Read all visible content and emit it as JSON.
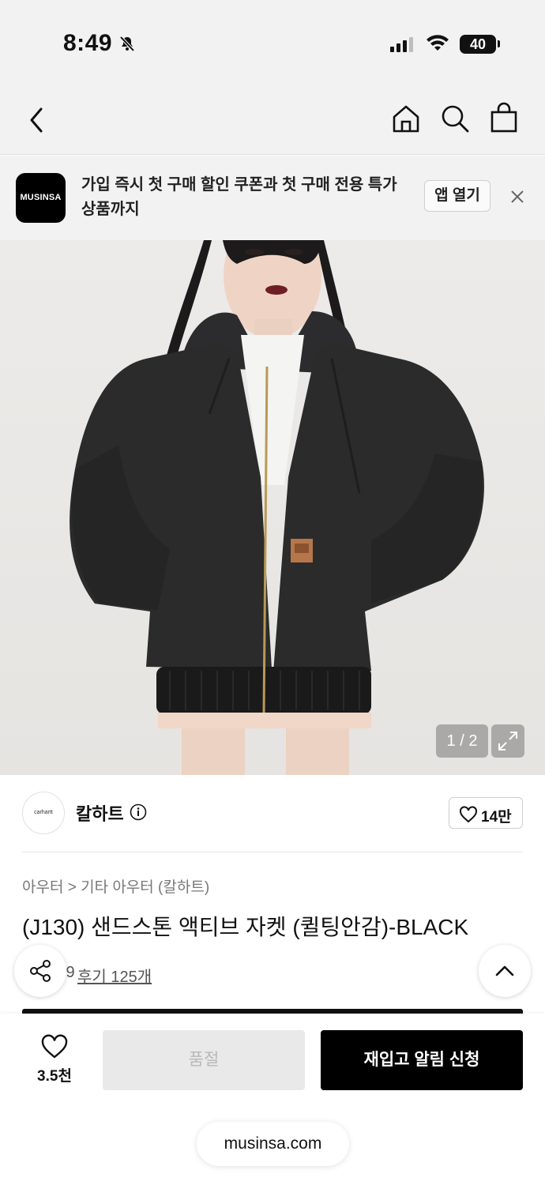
{
  "status_bar": {
    "time": "8:49",
    "battery": "40",
    "icons": [
      "bell-slash-icon",
      "signal-icon",
      "wifi-icon",
      "battery-icon"
    ]
  },
  "nav": {
    "icons": [
      "back-icon",
      "home-icon",
      "search-icon",
      "shopping-bag-icon"
    ]
  },
  "banner": {
    "logo_text": "MUSINSA",
    "message": "가입 즉시 첫 구매 할인 쿠폰과 첫 구매 전용 특가 상품까지",
    "open_app_label": "앱 열기"
  },
  "gallery": {
    "pager": "1 / 2"
  },
  "brand": {
    "logo_text": "carhartt",
    "name": "칼하트",
    "like_count": "14만"
  },
  "product": {
    "breadcrumb": "아우터 > 기타 아우터 (칼하트)",
    "title": "(J130) 샌드스톤 액티브 자켓 (퀼팅안감)-BLACK",
    "rating_fragment": ".9",
    "review_link": "후기 125개"
  },
  "bottom_bar": {
    "wish_count": "3.5천",
    "soldout_label": "품절",
    "restock_label": "재입고 알림 신청",
    "url": "musinsa.com"
  },
  "colors": {
    "primary": "#000000",
    "muted_bg": "#f2f2f2",
    "disabled": "#e9e9e9"
  }
}
